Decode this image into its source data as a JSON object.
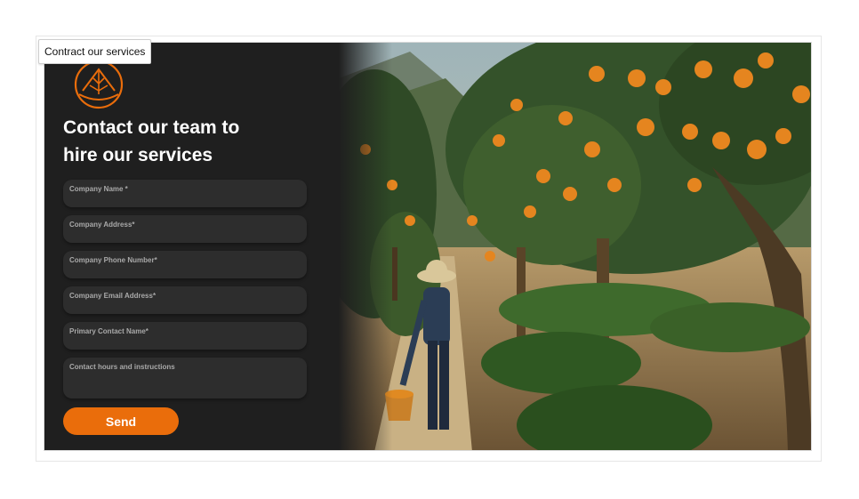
{
  "tooltip": {
    "text": "Contract our services"
  },
  "hero": {
    "heading_line1": "Contact our team to",
    "heading_line2": "hire our services"
  },
  "form": {
    "fields": [
      {
        "label": "Company Name *",
        "value": ""
      },
      {
        "label": "Company Address*",
        "value": ""
      },
      {
        "label": "Company Phone Number*",
        "value": ""
      },
      {
        "label": "Company Email Address*",
        "value": ""
      },
      {
        "label": "Primary Contact Name*",
        "value": ""
      },
      {
        "label": "Contact hours and instructions",
        "value": ""
      }
    ],
    "submit_label": "Send"
  },
  "theme": {
    "accent": "#ea6d0b",
    "panel_bg": "#1f1f1f",
    "field_bg": "#2d2d2d"
  },
  "icons": {
    "logo": "orange-tree-logo-icon"
  },
  "photo": {
    "subject": "orange-grove-farmer-image"
  }
}
